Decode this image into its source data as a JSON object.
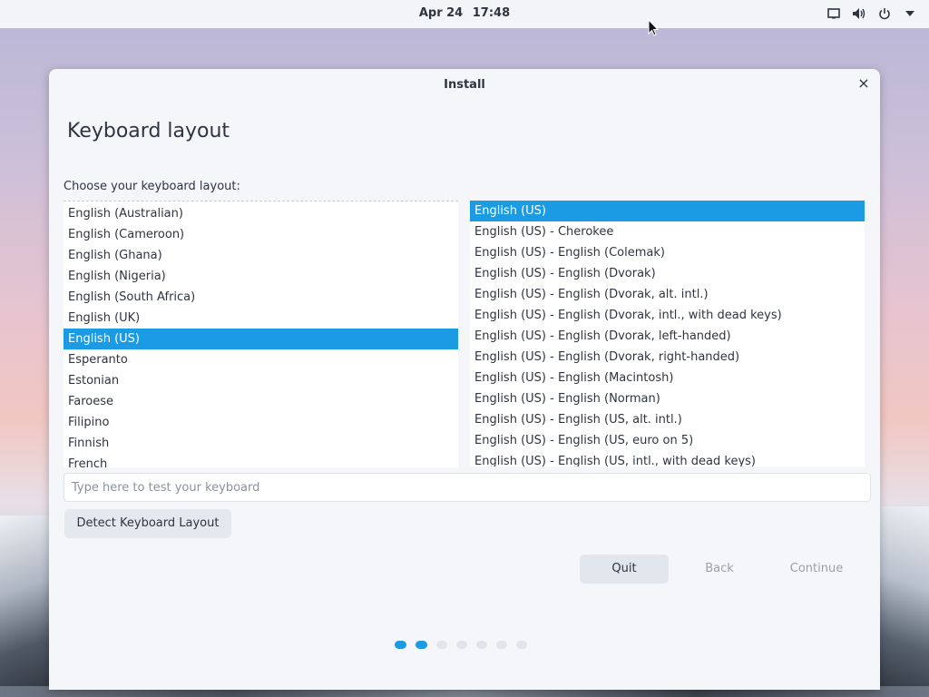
{
  "topbar": {
    "date": "Apr 24",
    "time": "17:48",
    "tray_icons": [
      "screen-icon",
      "volume-icon",
      "power-icon",
      "menu-down-icon"
    ]
  },
  "window": {
    "title": "Install",
    "close_symbol": "×",
    "heading": "Keyboard layout",
    "prompt": "Choose your keyboard layout:"
  },
  "layouts": [
    {
      "label": "English (Australian)",
      "selected": false
    },
    {
      "label": "English (Cameroon)",
      "selected": false
    },
    {
      "label": "English (Ghana)",
      "selected": false
    },
    {
      "label": "English (Nigeria)",
      "selected": false
    },
    {
      "label": "English (South Africa)",
      "selected": false
    },
    {
      "label": "English (UK)",
      "selected": false
    },
    {
      "label": "English (US)",
      "selected": true
    },
    {
      "label": "Esperanto",
      "selected": false
    },
    {
      "label": "Estonian",
      "selected": false
    },
    {
      "label": "Faroese",
      "selected": false
    },
    {
      "label": "Filipino",
      "selected": false
    },
    {
      "label": "Finnish",
      "selected": false
    },
    {
      "label": "French",
      "selected": false
    }
  ],
  "variants": [
    {
      "label": "English (US)",
      "selected": true
    },
    {
      "label": "English (US) - Cherokee",
      "selected": false
    },
    {
      "label": "English (US) - English (Colemak)",
      "selected": false
    },
    {
      "label": "English (US) - English (Dvorak)",
      "selected": false
    },
    {
      "label": "English (US) - English (Dvorak, alt. intl.)",
      "selected": false
    },
    {
      "label": "English (US) - English (Dvorak, intl., with dead keys)",
      "selected": false
    },
    {
      "label": "English (US) - English (Dvorak, left-handed)",
      "selected": false
    },
    {
      "label": "English (US) - English (Dvorak, right-handed)",
      "selected": false
    },
    {
      "label": "English (US) - English (Macintosh)",
      "selected": false
    },
    {
      "label": "English (US) - English (Norman)",
      "selected": false
    },
    {
      "label": "English (US) - English (US, alt. intl.)",
      "selected": false
    },
    {
      "label": "English (US) - English (US, euro on 5)",
      "selected": false
    },
    {
      "label": "English (US) - English (US, intl., with dead keys)",
      "selected": false
    }
  ],
  "test_input": {
    "placeholder": "Type here to test your keyboard",
    "value": ""
  },
  "buttons": {
    "detect": "Detect Keyboard Layout",
    "quit": "Quit",
    "back": "Back",
    "continue": "Continue"
  },
  "progress": {
    "total_steps": 7,
    "completed_steps": 2
  },
  "colors": {
    "accent": "#1a9be4",
    "window_bg": "#f5f6f9",
    "text": "#2e3440"
  }
}
